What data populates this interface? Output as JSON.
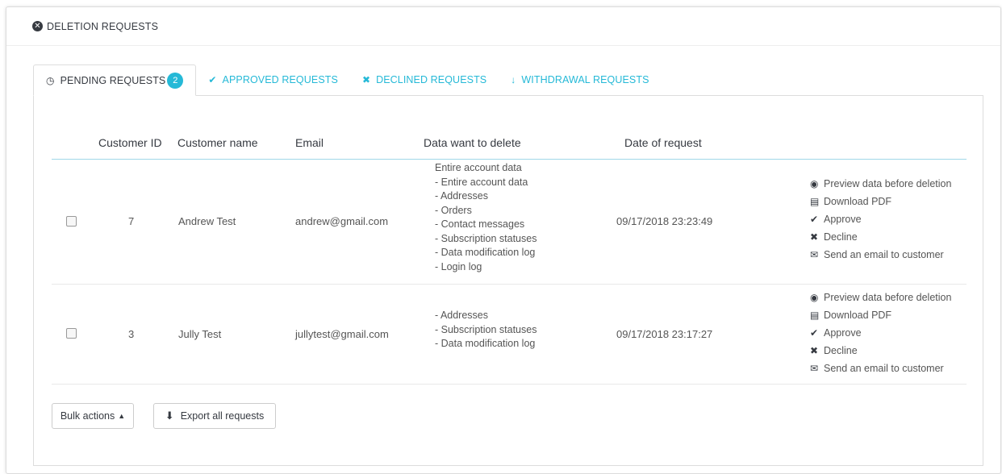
{
  "panel": {
    "title": "DELETION REQUESTS"
  },
  "tabs": [
    {
      "label": "PENDING REQUESTS",
      "badge": "2",
      "icon": "clock-icon"
    },
    {
      "label": "APPROVED REQUESTS",
      "icon": "check-icon"
    },
    {
      "label": "DECLINED REQUESTS",
      "icon": "times-icon"
    },
    {
      "label": "WITHDRAWAL REQUESTS",
      "icon": "arrow-down-icon"
    }
  ],
  "table": {
    "headers": [
      "Customer ID",
      "Customer name",
      "Email",
      "Data want to delete",
      "Date of request"
    ],
    "rows": [
      {
        "id": "7",
        "name": "Andrew Test",
        "email": "andrew@gmail.com",
        "data": [
          "Entire account data",
          "- Entire account data",
          "- Addresses",
          "- Orders",
          "- Contact messages",
          "- Subscription statuses",
          "- Data modification log",
          "- Login log"
        ],
        "date": "09/17/2018 23:23:49"
      },
      {
        "id": "3",
        "name": "Jully Test",
        "email": "jullytest@gmail.com",
        "data": [
          "- Addresses",
          "- Subscription statuses",
          "- Data modification log"
        ],
        "date": "09/17/2018 23:17:27"
      }
    ]
  },
  "actions": {
    "preview": "Preview data before deletion",
    "download": "Download PDF",
    "approve": "Approve",
    "decline": "Decline",
    "email": "Send an email to customer"
  },
  "footer": {
    "bulk": "Bulk actions",
    "export": "Export all requests"
  },
  "colors": {
    "accent": "#25b9d7",
    "text": "#363a41"
  }
}
